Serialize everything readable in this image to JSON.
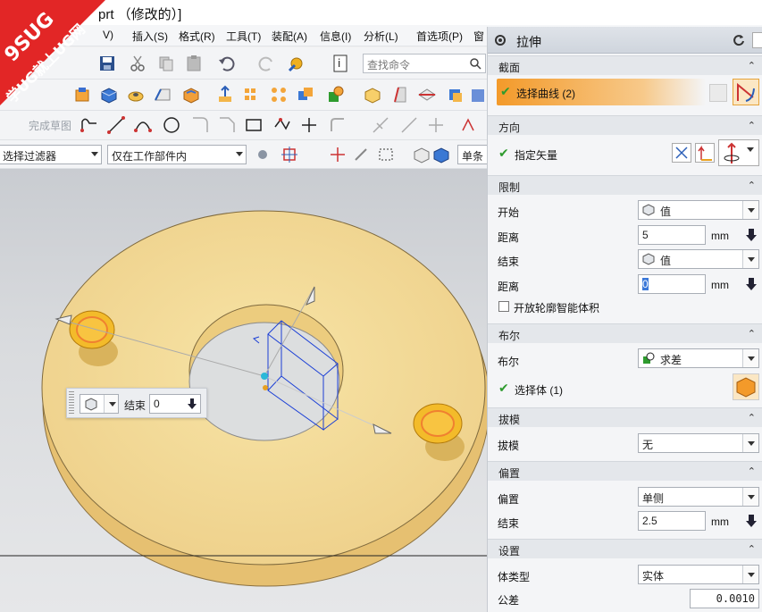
{
  "window": {
    "title": "X...prt （修改的）]",
    "title_left": "X",
    "title_right": "prt （修改的）]"
  },
  "menu": {
    "items": [
      "V)",
      "插入(S)",
      "格式(R)",
      "工具(T)",
      "装配(A)",
      "信息(I)",
      "分析(L)",
      "首选项(P)",
      "窗"
    ]
  },
  "toolbar": {
    "search_placeholder": "查找命令",
    "sketch_label": "完成草图",
    "filter_value": "选择过滤器",
    "scope_value": "仅在工作部件内",
    "single_value": "单条"
  },
  "viewport": {
    "float_label": "结束",
    "float_value": "0"
  },
  "watermark": {
    "line1": "9SUG",
    "line2": "学UG就上UG网"
  },
  "panel": {
    "title": "拉伸",
    "sections": {
      "section": "截面",
      "direction": "方向",
      "limits": "限制",
      "boolean": "布尔",
      "draft": "拔模",
      "offset": "偏置",
      "settings": "设置"
    },
    "select_curve": "选择曲线 (2)",
    "specify_vector": "指定矢量",
    "start_label": "开始",
    "start_value": "值",
    "distance_label": "距离",
    "distance1": "5",
    "end_label": "结束",
    "end_value": "值",
    "distance2": "0",
    "unit": "mm",
    "open_profile": "开放轮廓智能体积",
    "boolean_label": "布尔",
    "boolean_value": "求差",
    "select_body": "选择体 (1)",
    "draft_label": "拔模",
    "draft_value": "无",
    "offset_label": "偏置",
    "offset_value": "单侧",
    "offset_end_label": "结束",
    "offset_end_value": "2.5",
    "body_type_label": "体类型",
    "body_type_value": "实体",
    "tolerance_label": "公差",
    "tolerance_value": "0.0010"
  },
  "colors": {
    "accent": "#f39c34",
    "part": "#f2d98c",
    "check": "#2e9b2e"
  }
}
